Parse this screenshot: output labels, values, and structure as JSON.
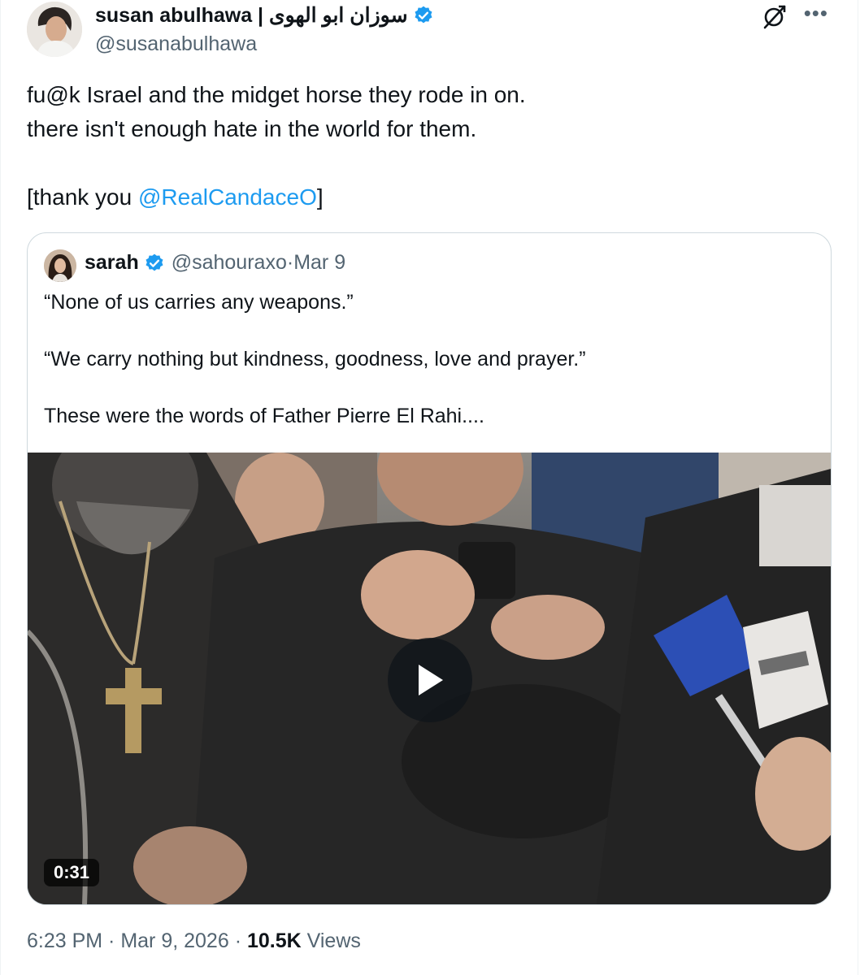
{
  "post": {
    "author_name": "susan abulhawa | سوزان ابو الهوى",
    "handle": "@susanabulhawa",
    "text_lines": "fu@k Israel and the midget horse they rode in on.\nthere isn't enough hate in the world for them.\n\n[thank you ",
    "mention": "@RealCandaceO",
    "text_end": "]",
    "time": "6:23 PM",
    "date": "Mar 9, 2026",
    "separator": " · ",
    "views_count": "10.5K",
    "views_label": "Views"
  },
  "quote": {
    "name": "sarah",
    "handle": "@sahouraxo",
    "date": "Mar 9",
    "meta_separator": " · ",
    "text": "“None of us carries any weapons.”\n\n“We carry nothing but kindness, goodness, love and prayer.”\n\nThese were the words of Father Pierre El Rahi....",
    "video_duration": "0:31"
  },
  "icons": {
    "verified": "verified-badge-icon",
    "grok": "grok-icon",
    "more": "more-icon",
    "play": "play-icon"
  },
  "colors": {
    "accent": "#1d9bf0",
    "secondary_text": "#536471",
    "primary_text": "#0f1419"
  }
}
